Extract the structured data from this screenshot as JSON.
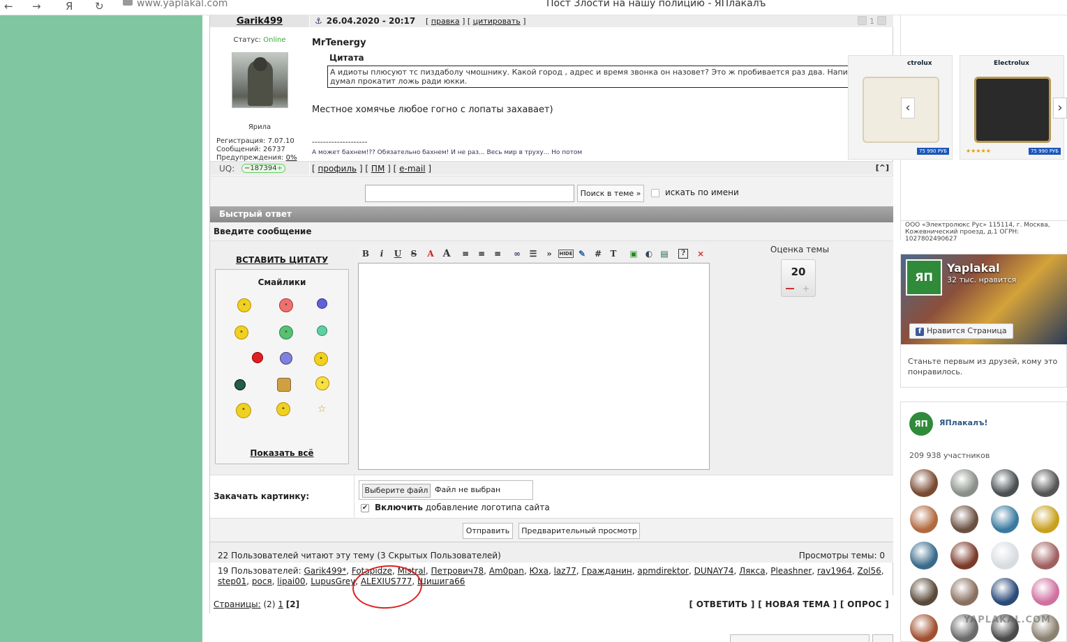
{
  "browser": {
    "back_icon": "←",
    "forward_icon": "→",
    "yandex_icon": "Я",
    "reload_icon": "↻",
    "url": "www.yaplakal.com",
    "title": "Пост Злости на нашу полицию - ЯПлакалъ"
  },
  "post": {
    "author": "Garik499",
    "date": "26.04.2020 - 20:17",
    "edit_label": "правка",
    "quote_label": "цитировать",
    "rating_count": "1",
    "status_label": "Статус:",
    "status_value": "Online",
    "user_title": "Ярила",
    "registration": "Регистрация: 7.07.10",
    "messages": "Сообщений: 26737",
    "warnings_label": "Предупреждения:",
    "warnings_value": "0%",
    "quoted_user": "MrTenergy",
    "quote_title": "Цитата",
    "quote_text": "А идиоты плюсуют тс пиздаболу чмошнику. Какой город , адрес и время звонка он назовет? Это ж пробивается раз два. Написал и думал прокатит ложь ради юкки.",
    "body": "Местное хомячье любое гогно с лопаты захавает)",
    "signature_sep": "--------------------",
    "signature": "А может бахнем!?? Обязательно бахнем! И не раз... Весь мир в труху... Но потом",
    "uq_label": "UQ:",
    "uq_value": "187394",
    "profile_link": "профиль",
    "pm_link": "ПМ",
    "email_link": "e-mail",
    "top_link": "[^]"
  },
  "search": {
    "button": "Поиск в теме »",
    "by_name": "искать по имени"
  },
  "quick_reply": {
    "header": "Быстрый ответ",
    "message_label": "Введите сообщение",
    "insert_quote": "ВСТАВИТЬ ЦИТАТУ",
    "smileys_title": "Смайлики",
    "show_all": "Показать всё",
    "rating_label": "Оценка темы",
    "rating_value": "20",
    "upload_label": "Закачать картинку:",
    "choose_file": "Выберите файл",
    "no_file": "Файл не выбран",
    "logo_bold": "Включить",
    "logo_rest": " добавление логотипа сайта",
    "submit": "Отправить",
    "preview": "Предварительный просмотр"
  },
  "toolbar": [
    "B",
    "i",
    "U",
    "S",
    "A",
    "A",
    "≡",
    "≡",
    "≡",
    "∞",
    "☰",
    "»",
    "HIDE",
    "✎",
    "#",
    "T",
    "▣",
    "◐",
    "▤",
    "?",
    "×"
  ],
  "readers": {
    "summary": "22 Пользователей читают эту тему (3 Скрытых Пользователей)",
    "views": "Просмотры темы: 0",
    "count_label": "19 Пользователей:",
    "users": [
      "Garik499*",
      "Fotapidze",
      "Mistral",
      "Петрович78",
      "Am0pan",
      "Юха",
      "laz77",
      "Гражданин",
      "apmdirektor",
      "DUNAY74",
      "Ляксa",
      "Pleashner",
      "rav1964",
      "Zol56",
      "step01",
      "рося",
      "lipai00",
      "LupusGrey",
      "ALEXIUS777",
      "Шишига66"
    ]
  },
  "pagination": {
    "label": "Страницы:",
    "count": "(2)",
    "page1": "1",
    "current": "[2]",
    "reply": "[ ОТВЕТИТЬ ]",
    "new_topic": "[ НОВАЯ ТЕМА ]",
    "poll": "[ ОПРОС ]"
  },
  "ad": {
    "brand1": "ctrolux",
    "brand2": "Electrolux",
    "price": "75 990 РУБ",
    "prev_icon": "‹",
    "next_icon": "›",
    "footer": "ООО «Электролюкс Рус» 115114, г. Москва, Кожевнический проезд, д.1 ОГРН: 1027802490627"
  },
  "facebook": {
    "logo": "ЯП",
    "name": "Yaplakal",
    "likes": "32 тыс. нравится",
    "like_button": "Нравится Страница",
    "text": "Станьте первым из друзей, кому это понравилось."
  },
  "vk": {
    "logo": "ЯП",
    "name": "ЯПлакалъ!",
    "members": "209 938 участников",
    "watermark": "YAPLAKAL.COM"
  },
  "colors": {
    "page_green": "#80c6a0",
    "online": "#33aa33",
    "annotation": "#dd2222"
  }
}
